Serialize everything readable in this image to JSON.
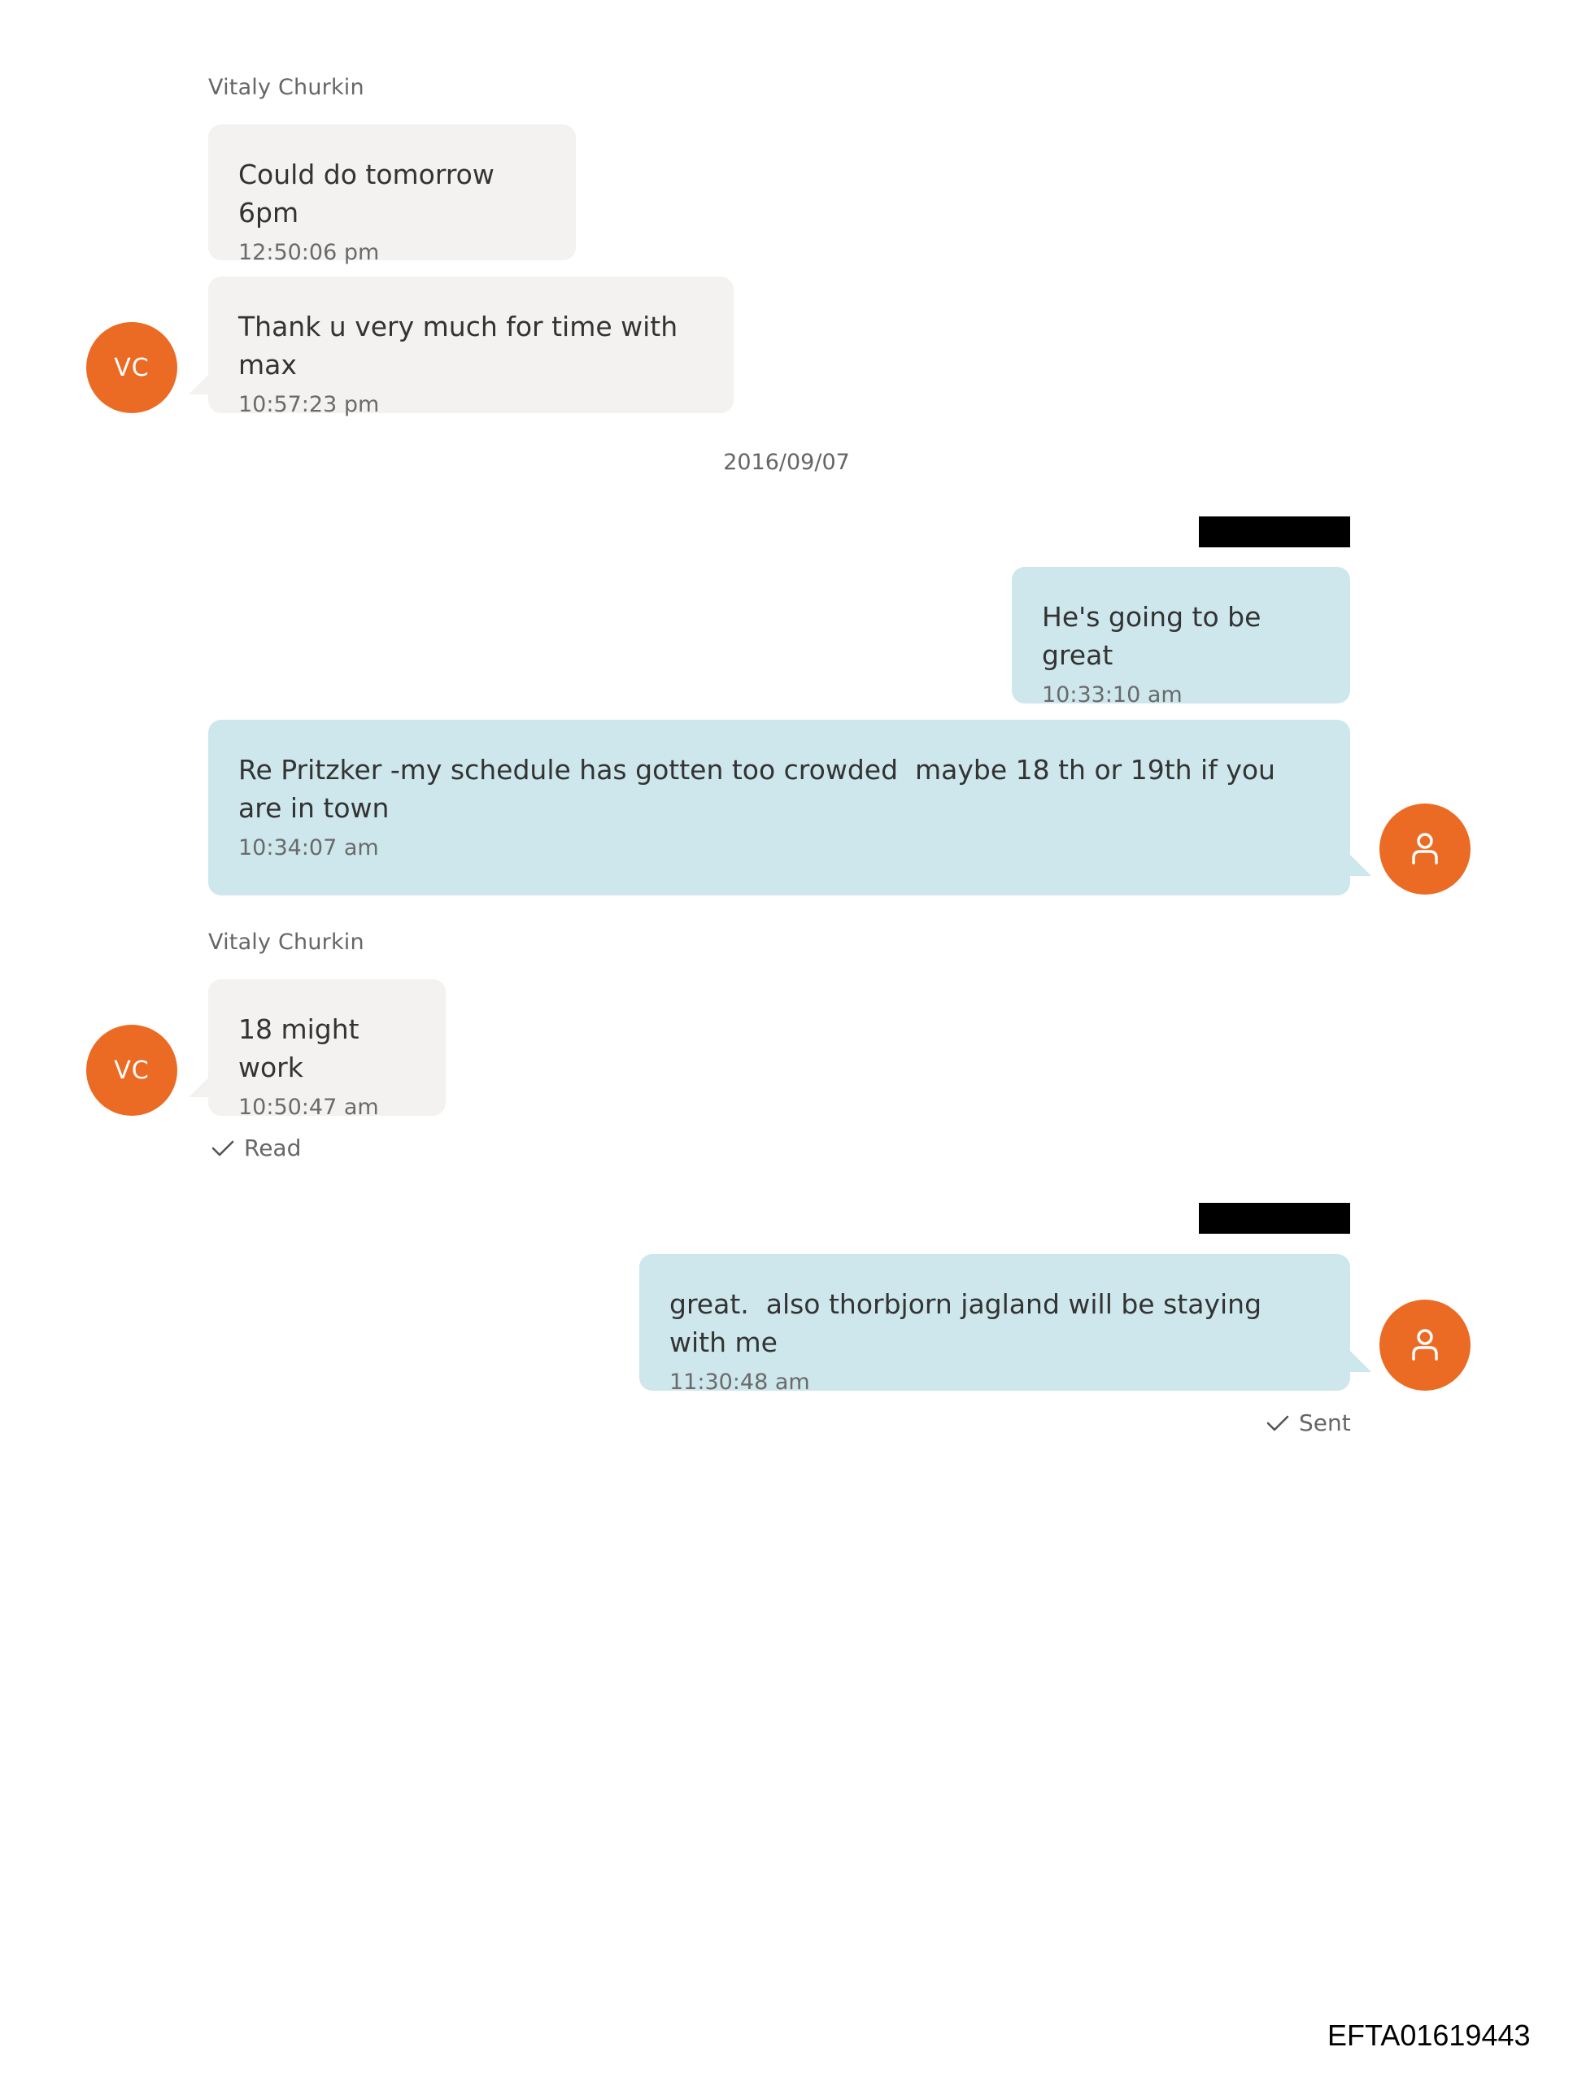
{
  "colors": {
    "avatar": "#ec6b24",
    "incoming_bubble": "#f3f2f0",
    "outgoing_bubble": "#cde7ec",
    "redaction": "#000000"
  },
  "conversation": {
    "group1": {
      "sender": "Vitaly Churkin",
      "avatar_initials": "VC",
      "messages": [
        {
          "text": "Could do tomorrow 6pm",
          "time": "12:50:06 pm"
        },
        {
          "text": "Thank u very much for time with max",
          "time": "10:57:23 pm"
        }
      ]
    },
    "date_separator": "2016/09/07",
    "group2": {
      "sender_redacted": true,
      "avatar_icon": "person-icon",
      "messages": [
        {
          "text": "He's going to be great",
          "time": "10:33:10 am"
        },
        {
          "text": "Re Pritzker -my schedule has gotten too crowded  maybe 18 th or 19th if you are in town",
          "time": "10:34:07 am"
        }
      ]
    },
    "group3": {
      "sender": "Vitaly Churkin",
      "avatar_initials": "VC",
      "messages": [
        {
          "text": "18 might work",
          "time": "10:50:47 am"
        }
      ],
      "status": "Read",
      "status_icon": "check-icon"
    },
    "group4": {
      "sender_redacted": true,
      "avatar_icon": "person-icon",
      "messages": [
        {
          "text": "great.  also thorbjorn jagland will be staying with me",
          "time": "11:30:48 am"
        }
      ],
      "status": "Sent",
      "status_icon": "check-icon"
    }
  },
  "footer": {
    "document_id": "EFTA01619443"
  }
}
